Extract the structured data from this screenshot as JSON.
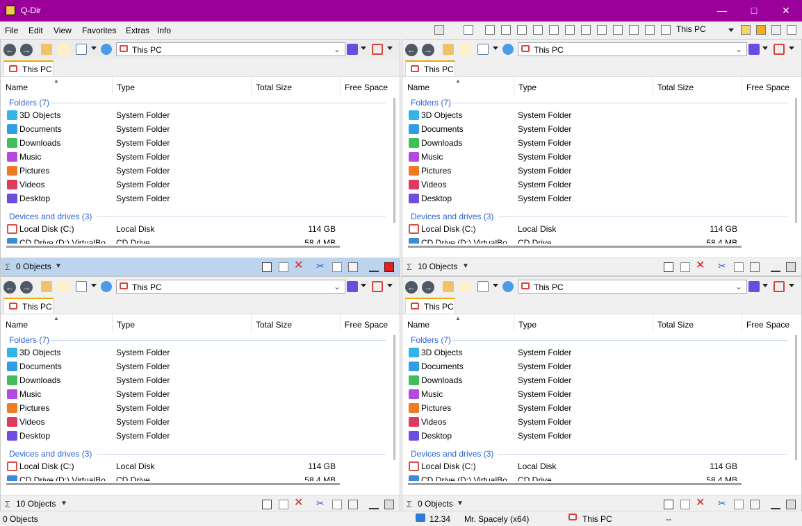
{
  "window": {
    "title": "Q-Dir"
  },
  "menu": [
    "File",
    "Edit",
    "View",
    "Favorites",
    "Extras",
    "Info"
  ],
  "toolbar": {
    "this_pc": "This PC"
  },
  "address": "This PC",
  "tab_label": "This PC",
  "columns": {
    "name": "Name",
    "type": "Type",
    "total": "Total Size",
    "free": "Free Space"
  },
  "groups": {
    "folders": "Folders (7)",
    "drives": "Devices and drives (3)"
  },
  "folders": [
    {
      "name": "3D Objects",
      "type": "System Folder",
      "color": "#32b5e6"
    },
    {
      "name": "Documents",
      "type": "System Folder",
      "color": "#2f9ee3"
    },
    {
      "name": "Downloads",
      "type": "System Folder",
      "color": "#3fbe5a"
    },
    {
      "name": "Music",
      "type": "System Folder",
      "color": "#b34ae0"
    },
    {
      "name": "Pictures",
      "type": "System Folder",
      "color": "#f07a22"
    },
    {
      "name": "Videos",
      "type": "System Folder",
      "color": "#e03a5f"
    },
    {
      "name": "Desktop",
      "type": "System Folder",
      "color": "#6e4de0"
    }
  ],
  "drives": [
    {
      "name": "Local Disk (C:)",
      "type": "Local Disk",
      "size": "114 GB"
    },
    {
      "name": "CD Drive (D:) VirtualBo",
      "type": "CD Drive",
      "size": "58.4 MB"
    }
  ],
  "panes": [
    {
      "count": "0 Objects",
      "active": true
    },
    {
      "count": "10 Objects",
      "active": false
    },
    {
      "count": "10 Objects",
      "active": false
    },
    {
      "count": "0 Objects",
      "active": false
    }
  ],
  "bottom": {
    "left": "0 Objects",
    "time": "12.34",
    "user": "Mr. Spacely (x64)",
    "location": "This PC",
    "right": "--"
  }
}
